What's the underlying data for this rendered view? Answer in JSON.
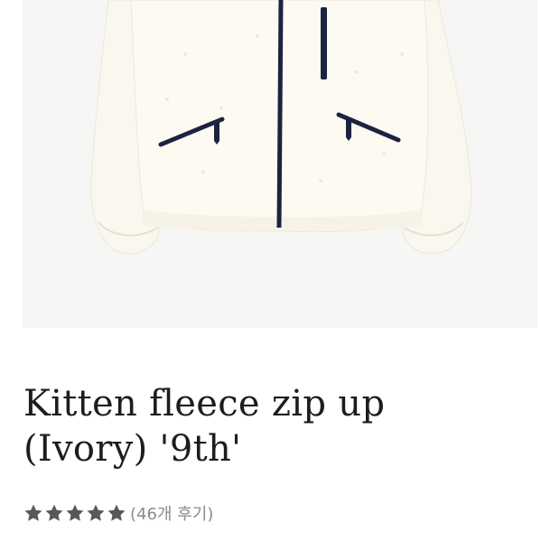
{
  "product": {
    "image_icon": "fleece-jacket-photo",
    "title_line1": "Kitten fleece zip up",
    "title_line2": "(Ivory) '9th'",
    "rating": 5,
    "rating_max": 5,
    "review_text": "(46개 후기)"
  },
  "colors": {
    "star": "#585858",
    "title": "#1d1d1d",
    "review": "#8a8a8a",
    "jacket": "#fbf8ee",
    "zipper": "#1c2340"
  }
}
